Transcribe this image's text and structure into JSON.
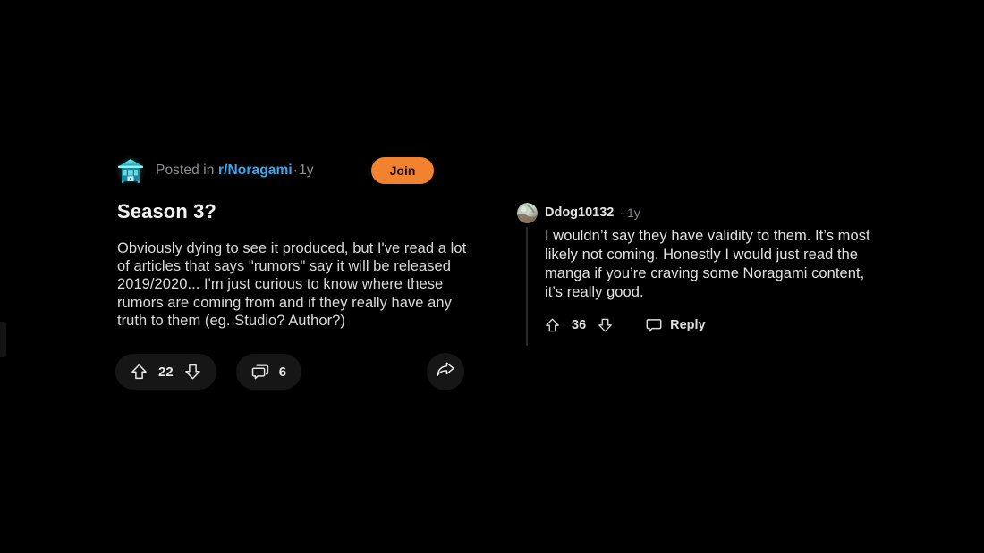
{
  "post": {
    "subreddit_icon_name": "shrine-icon",
    "posted_prefix": "Posted in",
    "subreddit": "r/Noragami",
    "separator": "·",
    "age": "1y",
    "join_label": "Join",
    "title": "Season 3?",
    "body": "Obviously dying to see it produced, but I've read a lot of articles that says \"rumors\" say it will be released 2019/2020... I'm just curious to know where these rumors are coming from and if they really have any truth to them (eg. Studio? Author?)",
    "upvotes": "22",
    "comment_count": "6"
  },
  "comment": {
    "author": "Ddog10132",
    "separator": "·",
    "age": "1y",
    "body": "I wouldn’t say they have validity to them. It’s most likely not coming. Honestly I would just read the manga if you’re craving some Noragami content, it’s really good.",
    "upvotes": "36",
    "reply_label": "Reply"
  },
  "colors": {
    "background": "#000000",
    "accent_join": "#f2832e",
    "link_blue": "#3aa9f0",
    "pill_bg": "#161616",
    "text_primary": "#e6e6e6",
    "text_muted": "#8e9094",
    "thread_line": "#2a2a2a",
    "sub_icon_cyan": "#4ee0e0"
  }
}
